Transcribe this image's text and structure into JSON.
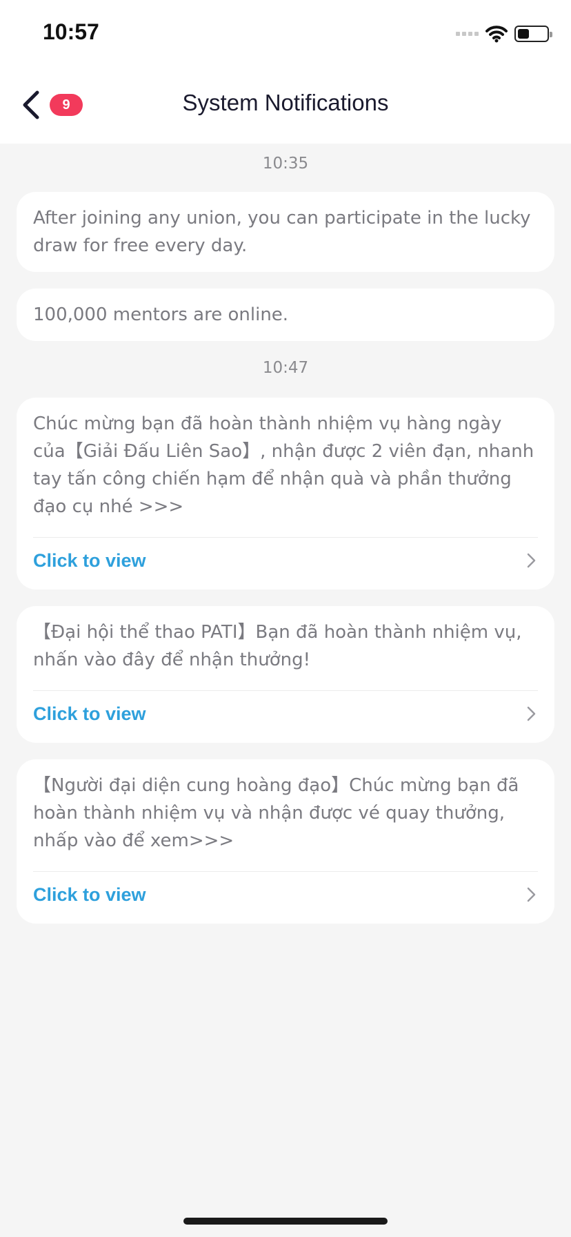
{
  "status_bar": {
    "time": "10:57"
  },
  "header": {
    "title": "System Notifications",
    "badge_count": "9"
  },
  "groups": [
    {
      "time": "10:35"
    },
    {
      "time": "10:47"
    }
  ],
  "messages": [
    {
      "text": "After joining any union, you can participate in the lucky draw for free every day."
    },
    {
      "text": "100,000 mentors are online."
    },
    {
      "text": "Chúc mừng bạn đã hoàn thành nhiệm vụ hàng ngày của【Giải Đấu Liên Sao】, nhận được 2 viên đạn, nhanh tay tấn công chiến hạm để nhận quà và phần thưởng đạo cụ nhé >>>",
      "action": "Click to view"
    },
    {
      "text": "【Đại hội thể thao PATI】Bạn đã hoàn thành nhiệm vụ, nhấn vào đây để nhận thưởng!",
      "action": "Click to view"
    },
    {
      "text": "【Người đại diện cung hoàng đạo】Chúc mừng bạn đã hoàn thành nhiệm vụ và nhận được vé quay thưởng, nhấp vào để xem>>>",
      "action": "Click to view"
    }
  ],
  "icons": {
    "back": "chevron-left-icon",
    "chevron": "chevron-right-icon",
    "wifi": "wifi-icon",
    "battery": "battery-icon",
    "signal": "signal-icon"
  },
  "colors": {
    "badge": "#f23a5b",
    "link": "#2ea0dc",
    "background": "#f5f5f5",
    "title": "#1a1a2e"
  }
}
